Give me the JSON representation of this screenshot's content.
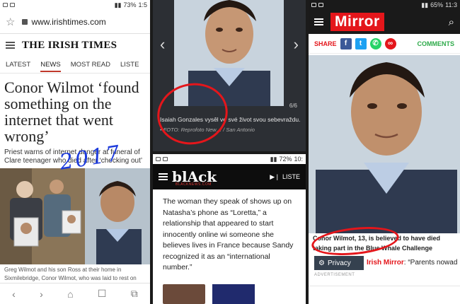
{
  "irish_times": {
    "status": {
      "battery": "73%",
      "time": "1:5"
    },
    "url": "www.irishtimes.com",
    "masthead": "THE IRISH TIMES",
    "tabs": [
      "LATEST",
      "NEWS",
      "MOST READ",
      "LISTE"
    ],
    "active_tab": "NEWS",
    "headline": "Conor Wilmot ‘found something on the internet that went wrong’",
    "standfirst": "Priest warns of internet danger at funeral of Clare teenager who died after ‘checking out’",
    "annotation": "2017",
    "caption": "Greg Wilmot and his son Ross at their home in Sixmilebridge, Conor Wilmot, who was laid to rest on Tuesday"
  },
  "gallery": {
    "counter": "6/6",
    "caption": "Isaiah Gonzales vysêl ve své život svou sebevraždu.",
    "credit": "• FOTO: Reprofoto New… / San Antonio"
  },
  "black": {
    "status": {
      "battery": "72%",
      "time": "10:"
    },
    "logo": "blAck",
    "logo_sub": "BLACKNEWS.COM",
    "listen": "LISTE",
    "body": "The woman they speak of shows up on Natasha’s phone as “Loretta,” a relationship that appeared to start innocently online wi someone she believes lives in France because Sandy recognized it as an “international number.”"
  },
  "mirror": {
    "status": {
      "battery": "65%",
      "time": "11:3"
    },
    "logo": "Mirror",
    "share_label": "SHARE",
    "comments_label": "COMMENTS",
    "caption": "Conor Wilmot, 13, is believed to have died taking part in the Blue Whale Challenge",
    "privacy": "Privacy",
    "related_brand": "Irish Mirror",
    "related_text": ": “Parents nowad",
    "advert": "ADVERTISEMENT"
  },
  "colors": {
    "mirror_red": "#e4161b",
    "annotation_blue": "#1d3bdc",
    "annotation_red": "#e4161b"
  }
}
